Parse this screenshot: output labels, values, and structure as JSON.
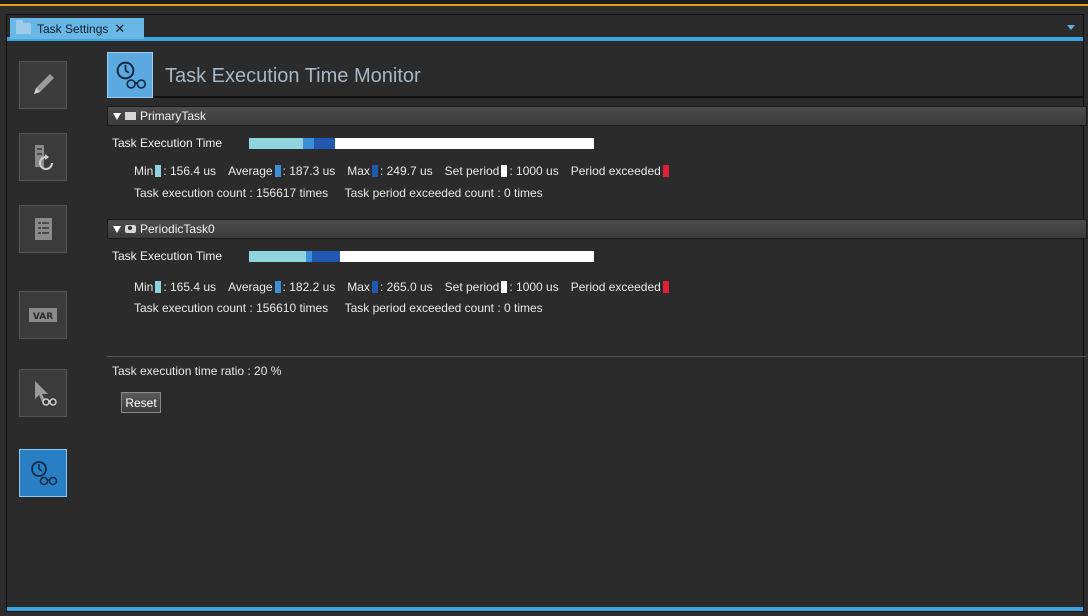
{
  "tab": {
    "title": "Task Settings",
    "close": "✕"
  },
  "header": {
    "title": "Task Execution Time Monitor",
    "icon": "stopwatch-glasses-icon"
  },
  "sidebar": {
    "items": [
      {
        "name": "pencil-icon",
        "active": false
      },
      {
        "name": "io-refresh-icon",
        "active": false
      },
      {
        "name": "list-icon",
        "active": false
      },
      {
        "name": "var-icon",
        "label": "VAR",
        "active": false
      },
      {
        "name": "cursor-glasses-icon",
        "active": false
      },
      {
        "name": "stopwatch-glasses-icon",
        "active": true
      }
    ]
  },
  "colors": {
    "min": "#8fd3df",
    "average": "#3b8ed8",
    "max": "#2158b0",
    "set_period": "#ffffff",
    "period_exceeded": "#e02036"
  },
  "tasks": [
    {
      "name": "PrimaryTask",
      "exec_label": "Task Execution Time",
      "bar": {
        "min": 156.4,
        "average": 187.3,
        "max": 249.7,
        "set_period": 1000
      },
      "stats": {
        "min_label": "Min",
        "min_value": ": 156.4 us",
        "avg_label": "Average",
        "avg_value": ": 187.3 us",
        "max_label": "Max",
        "max_value": ": 249.7 us",
        "period_label": "Set period",
        "period_value": ": 1000 us",
        "exceeded_label": "Period exceeded"
      },
      "count_line": "Task execution count : 156617 times     Task period exceeded count : 0 times"
    },
    {
      "name": "PeriodicTask0",
      "exec_label": "Task Execution Time",
      "bar": {
        "min": 165.4,
        "average": 182.2,
        "max": 265.0,
        "set_period": 1000
      },
      "stats": {
        "min_label": "Min",
        "min_value": ": 165.4 us",
        "avg_label": "Average",
        "avg_value": ": 182.2 us",
        "max_label": "Max",
        "max_value": ": 265.0 us",
        "period_label": "Set period",
        "period_value": ": 1000 us",
        "exceeded_label": "Period exceeded"
      },
      "count_line": "Task execution count : 156610 times     Task period exceeded count : 0 times"
    }
  ],
  "ratio": "Task execution time ratio : 20 %",
  "reset_label": "Reset"
}
